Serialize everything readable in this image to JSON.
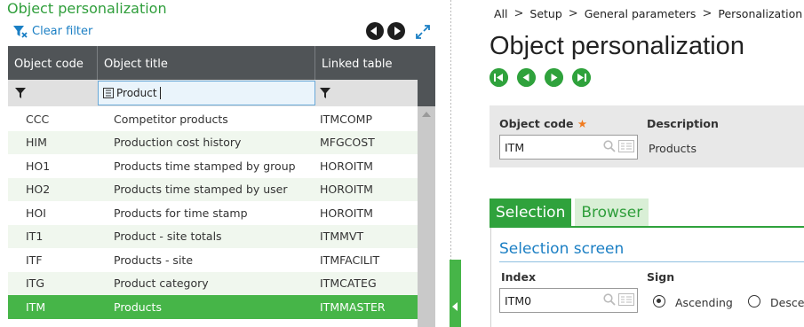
{
  "left_panel": {
    "title": "Object personalization",
    "clear_filter": "Clear filter",
    "columns": [
      "Object code",
      "Object title",
      "Linked table"
    ],
    "filter_value": "Product",
    "rows": [
      {
        "code": "CCC",
        "title": "Competitor products",
        "table": "ITMCOMP"
      },
      {
        "code": "HIM",
        "title": "Production cost history",
        "table": "MFGCOST"
      },
      {
        "code": "HO1",
        "title": "Products time stamped by group",
        "table": "HOROITM"
      },
      {
        "code": "HO2",
        "title": "Products time stamped by user",
        "table": "HOROITM"
      },
      {
        "code": "HOI",
        "title": "Products for time stamp",
        "table": "HOROITM"
      },
      {
        "code": "IT1",
        "title": "Product - site totals",
        "table": "ITMMVT"
      },
      {
        "code": "ITF",
        "title": "Products - site",
        "table": "ITMFACILIT"
      },
      {
        "code": "ITG",
        "title": "Product category",
        "table": "ITMCATEG"
      },
      {
        "code": "ITM",
        "title": "Products",
        "table": "ITMMASTER"
      }
    ],
    "selected_row": 8
  },
  "breadcrumb": {
    "items": [
      "All",
      "Setup",
      "General parameters",
      "Personalization"
    ],
    "separator": ">"
  },
  "page": {
    "title": "Object personalization"
  },
  "header": {
    "object_code_label": "Object code",
    "required_mark": "★",
    "object_code_value": "ITM",
    "description_label": "Description",
    "description_value": "Products"
  },
  "tabs": {
    "selection": "Selection",
    "browser": "Browser"
  },
  "section": {
    "title": "Selection screen",
    "index_label": "Index",
    "index_value": "ITM0",
    "sign_label": "Sign",
    "ascending": "Ascending",
    "descending": "Desce"
  },
  "colors": {
    "green": "#2fa23c",
    "selected_row": "#46b548",
    "blue_link": "#1b7fc4",
    "grid_header": "#505457"
  }
}
